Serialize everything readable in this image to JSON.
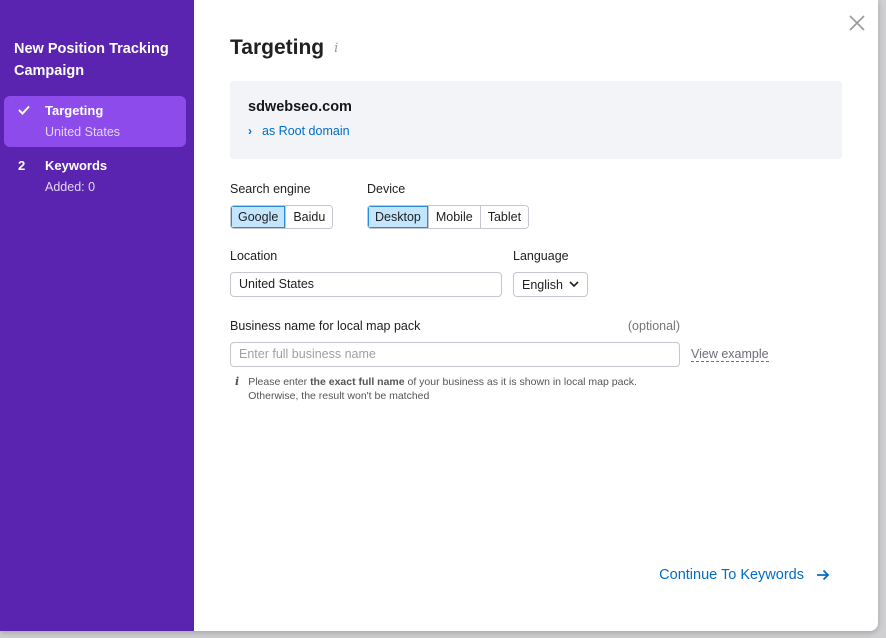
{
  "sidebar": {
    "title": "New Position Tracking Campaign",
    "steps": [
      {
        "marker": "",
        "title": "Targeting",
        "sub": "United States"
      },
      {
        "marker": "2",
        "title": "Keywords",
        "sub": "Added: 0"
      }
    ]
  },
  "main": {
    "title": "Targeting",
    "info_glyph": "i",
    "domain": "sdwebseo.com",
    "domain_type": "as Root domain",
    "search_engine": {
      "label": "Search engine",
      "options": [
        "Google",
        "Baidu"
      ],
      "selected": "Google"
    },
    "device": {
      "label": "Device",
      "options": [
        "Desktop",
        "Mobile",
        "Tablet"
      ],
      "selected": "Desktop"
    },
    "location": {
      "label": "Location",
      "value": "United States"
    },
    "language": {
      "label": "Language",
      "value": "English"
    },
    "business": {
      "label": "Business name for local map pack",
      "optional": "(optional)",
      "placeholder": "Enter full business name",
      "view_example": "View example",
      "hint_pre": "Please enter ",
      "hint_bold": "the exact full name",
      "hint_post": " of your business as it is shown in local map pack.",
      "hint_line2": "Otherwise, the result won't be matched"
    },
    "continue_label": "Continue To Keywords"
  },
  "colors": {
    "sidebar_bg": "#5b24b0",
    "active_step_bg": "#8c4bea",
    "link": "#006dca",
    "selected_option_bg": "#c4e5fe"
  }
}
